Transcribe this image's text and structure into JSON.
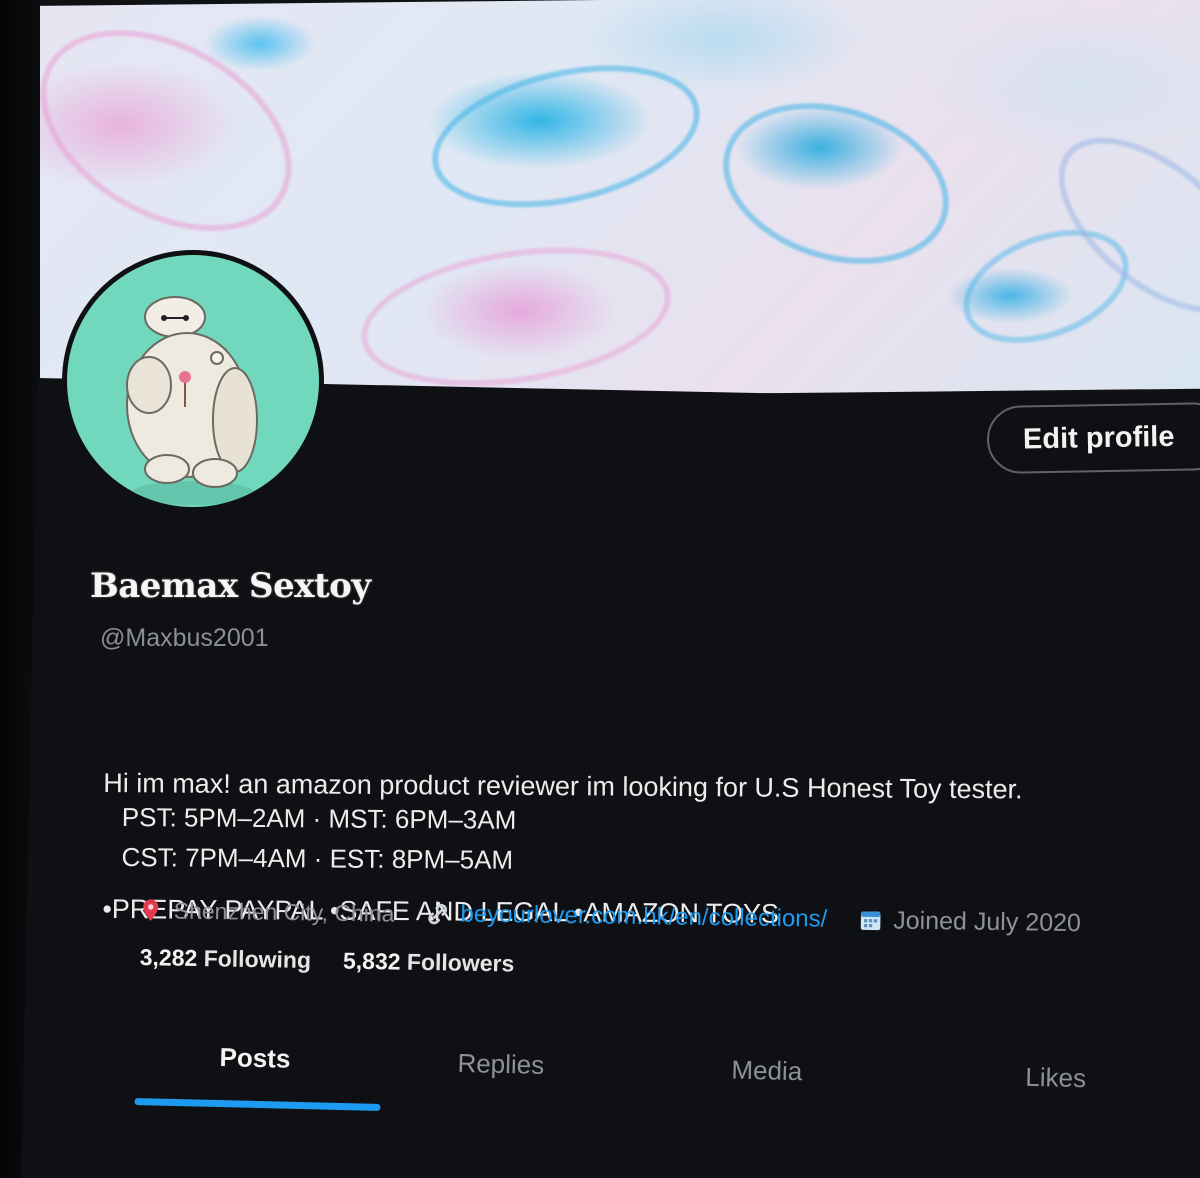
{
  "profile": {
    "display_name": "Baemax Sextoy",
    "handle": "@Maxbus2001",
    "bio_line1": "Hi im max! an amazon product reviewer im looking for U.S Honest Toy tester.",
    "bio_line2": "•PREPAY PAYPAL •SAFE AND LEGAL •AMAZON TOYS",
    "hours_line1": "PST: 5PM–2AM · MST: 6PM–3AM",
    "hours_line2": "CST: 7PM–4AM · EST: 8PM–5AM",
    "location": "Shenzhen City, China",
    "website": "beyourlover.com.hk/en/collections/",
    "joined": "Joined July 2020"
  },
  "counts": {
    "following_count": "3,282",
    "following_label": "Following",
    "followers_count": "5,832",
    "followers_label": "Followers"
  },
  "actions": {
    "edit_profile_label": "Edit profile"
  },
  "tabs": [
    {
      "label": "Posts",
      "active": true
    },
    {
      "label": "Replies",
      "active": false
    },
    {
      "label": "Media",
      "active": false
    },
    {
      "label": "Likes",
      "active": false
    }
  ],
  "icons": {
    "location": "location-pin-icon",
    "link": "link-icon",
    "calendar": "calendar-icon"
  },
  "colors": {
    "accent": "#1d9bf0",
    "background": "#0f1013",
    "avatar_bg": "#72d8bd",
    "secondary_text": "#8b8f94"
  }
}
